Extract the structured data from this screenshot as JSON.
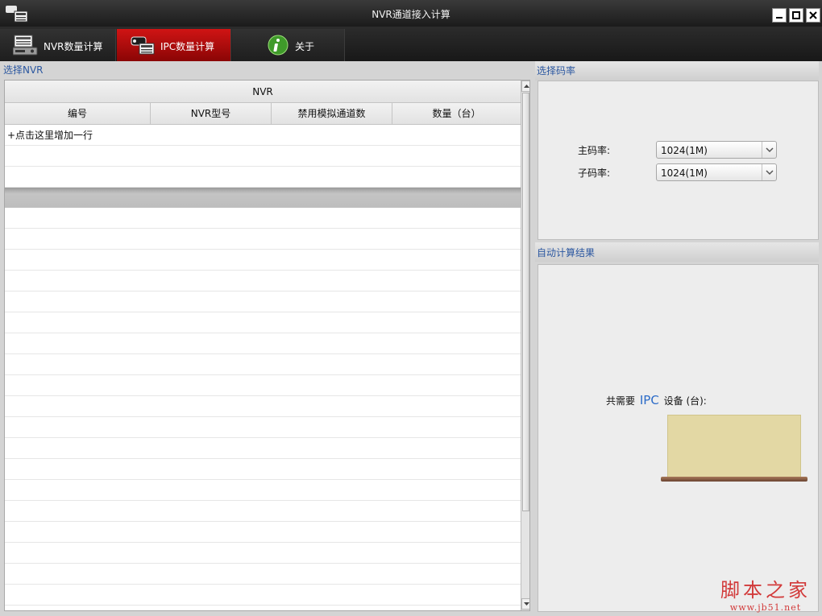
{
  "window": {
    "title": "NVR通道接入计算"
  },
  "tabs": [
    {
      "label": "NVR数量计算",
      "icon": "nvr-device-icon",
      "active": false
    },
    {
      "label": "IPC数量计算",
      "icon": "ipc-camera-icon",
      "active": true
    },
    {
      "label": "关于",
      "icon": "info-icon",
      "active": false
    }
  ],
  "left": {
    "section_label": "选择NVR",
    "table": {
      "group_header": "NVR",
      "columns": [
        "编号",
        "NVR型号",
        "禁用模拟通道数",
        "数量（台）"
      ],
      "add_row_text": "+点击这里增加一行"
    }
  },
  "bitrate": {
    "section_label": "选择码率",
    "main_label": "主码率:",
    "main_value": "1024(1M)",
    "sub_label": "子码率:",
    "sub_value": "1024(1M)"
  },
  "result": {
    "section_label": "自动计算结果",
    "prefix": "共需要",
    "highlight": "IPC",
    "suffix": "设备 (台):",
    "value": ""
  },
  "watermark": {
    "main": "脚本之家",
    "url": "www.jb51.net"
  },
  "colors": {
    "active_tab": "#c40f0f",
    "section_label": "#2b57a0",
    "highlight": "#2b6bc8",
    "result_box": "#e3d8a4"
  }
}
